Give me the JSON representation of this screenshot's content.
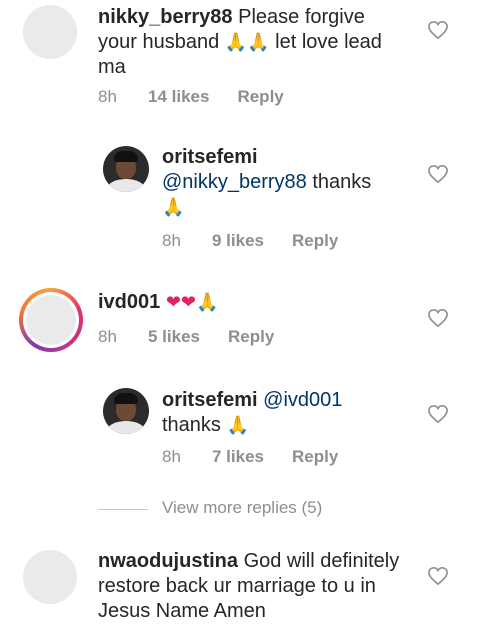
{
  "comments": [
    {
      "username": "nikky_berry88",
      "text_parts": [
        "Please forgive",
        "your husband",
        "let love lead",
        "ma"
      ],
      "time": "8h",
      "likes": "14 likes",
      "reply": "Reply"
    },
    {
      "username": "oritsefemi",
      "mention": "@nikky_berry88",
      "text": "thanks",
      "time": "8h",
      "likes": "9 likes",
      "reply": "Reply"
    },
    {
      "username": "ivd001",
      "time": "8h",
      "likes": "5 likes",
      "reply": "Reply"
    },
    {
      "username": "oritsefemi",
      "mention": "@ivd001",
      "text": "thanks",
      "time": "8h",
      "likes": "7 likes",
      "reply": "Reply"
    },
    {
      "username": "nwaodujustina",
      "text_parts": [
        "God will definitely",
        "restore back ur marriage to u in",
        "Jesus Name Amen"
      ]
    }
  ],
  "view_more_replies": "View more replies (5)",
  "emoji": {
    "pray": "🙏",
    "red_heart": "❤"
  },
  "icons": {
    "like": "heart-outline-icon"
  },
  "colors": {
    "mention": "#003569",
    "meta": "#8e8e8e",
    "text": "#262626"
  }
}
